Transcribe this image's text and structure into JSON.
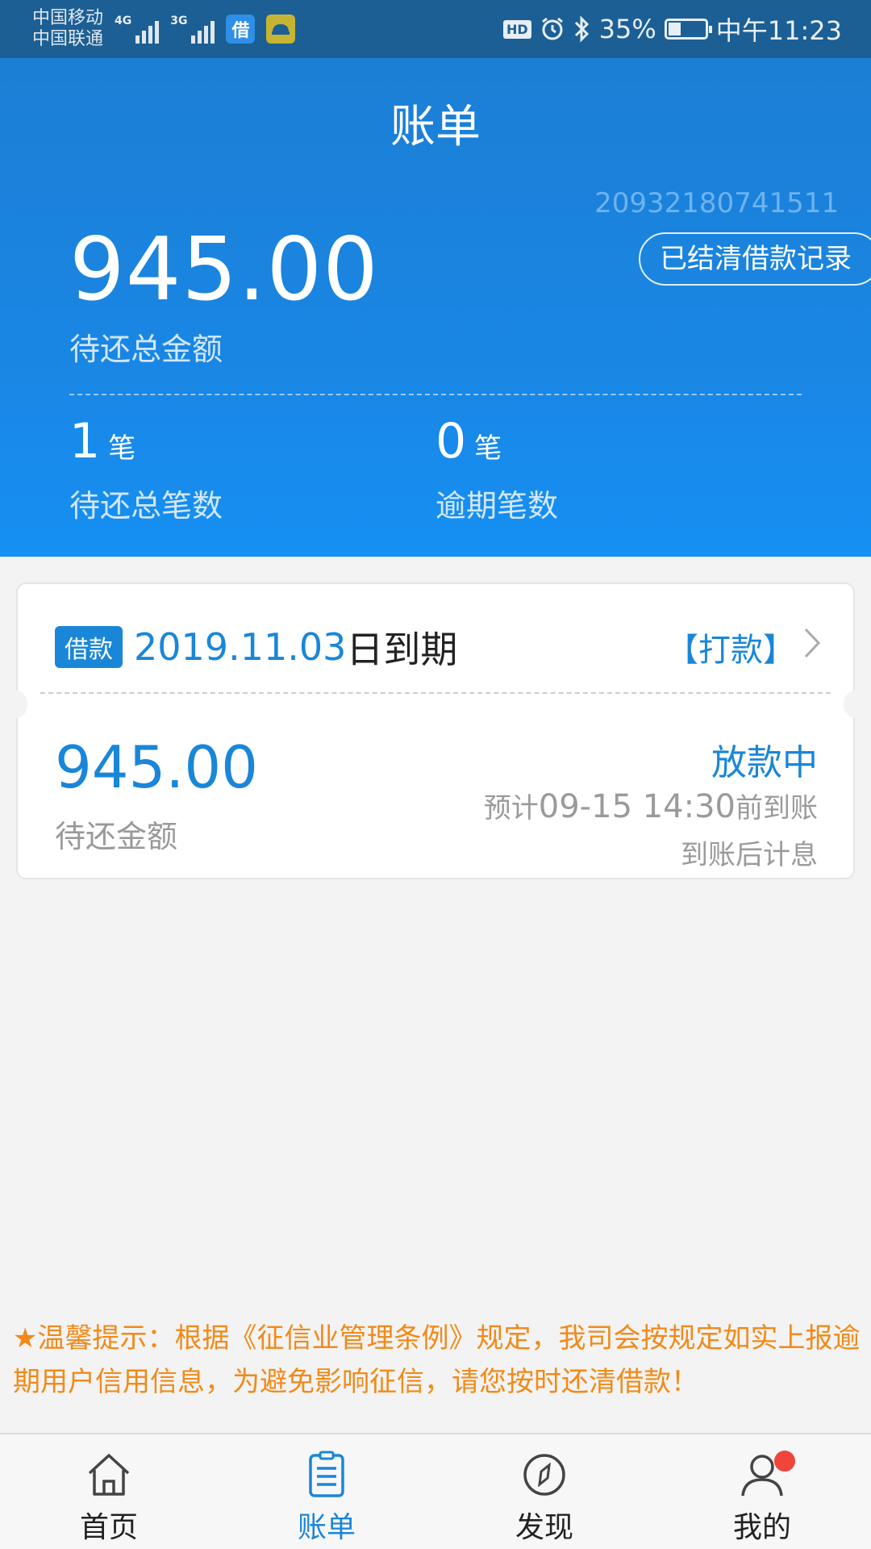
{
  "status_bar": {
    "carrier1": "中国移动",
    "carrier2": "中国联通",
    "net1": "4G",
    "net2": "3G",
    "app_icon1": "借",
    "hd": "HD",
    "battery": "35%",
    "battery_level": 0.35,
    "time": "中午11:23"
  },
  "header": {
    "title": "账单",
    "account_number": "20932180741511",
    "record_button": "已结清借款记录",
    "total_amount": "945.00",
    "total_label": "待还总金额",
    "stats": [
      {
        "num": "1",
        "unit": "笔",
        "label": "待还总笔数"
      },
      {
        "num": "0",
        "unit": "笔",
        "label": "逾期笔数"
      }
    ]
  },
  "bill": {
    "tag": "借款",
    "due_date": "2019.11.03",
    "due_suffix": "日到期",
    "pay_link": "【打款】",
    "amount": "945.00",
    "amount_label": "待还金额",
    "status": "放款中",
    "eta_prefix": "预计",
    "eta_time": "09-15 14:30",
    "eta_suffix": "前到账",
    "note": "到账后计息"
  },
  "tip": "★温馨提示：根据《征信业管理条例》规定，我司会按规定如实上报逾期用户信用信息，为避免影响征信，请您按时还清借款！",
  "nav": [
    {
      "label": "首页",
      "icon": "home-icon"
    },
    {
      "label": "账单",
      "icon": "bill-icon"
    },
    {
      "label": "发现",
      "icon": "compass-icon"
    },
    {
      "label": "我的",
      "icon": "user-icon"
    }
  ],
  "colors": {
    "primary": "#1a86d8",
    "warning": "#f28a17",
    "badge": "#f0443c"
  }
}
